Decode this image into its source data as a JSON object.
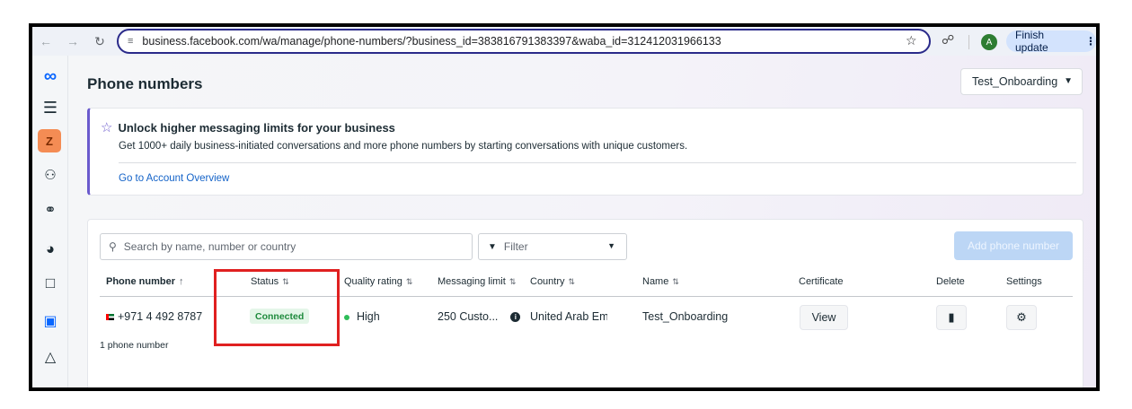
{
  "browser": {
    "url": "business.facebook.com/wa/manage/phone-numbers/?business_id=383816791383397&waba_id=312412031966133",
    "profile_initial": "A",
    "finish_update_label": "Finish update"
  },
  "rail": {
    "workspace_initial": "Z"
  },
  "header": {
    "title": "Phone numbers",
    "account_selector": "Test_Onboarding"
  },
  "banner": {
    "title": "Unlock higher messaging limits for your business",
    "description": "Get 1000+ daily business-initiated conversations and more phone numbers by starting conversations with unique customers.",
    "link": "Go to Account Overview"
  },
  "toolbar": {
    "search_placeholder": "Search by name, number or country",
    "filter_label": "Filter",
    "add_button": "Add phone number"
  },
  "table": {
    "columns": {
      "phone_number": "Phone number",
      "status": "Status",
      "quality_rating": "Quality rating",
      "messaging_limit": "Messaging limit",
      "country": "Country",
      "name": "Name",
      "certificate": "Certificate",
      "delete": "Delete",
      "settings": "Settings"
    },
    "rows": [
      {
        "phone_number": "+971 4 492 8787",
        "status": "Connected",
        "quality_rating": "High",
        "messaging_limit": "250 Custo...",
        "country": "United Arab Em",
        "name": "Test_Onboarding",
        "certificate_button": "View"
      }
    ],
    "count_label": "1 phone number"
  },
  "colors": {
    "accent": "#0866ff",
    "status_connected": "#1e8a3c",
    "highlight_box": "#e02020"
  }
}
